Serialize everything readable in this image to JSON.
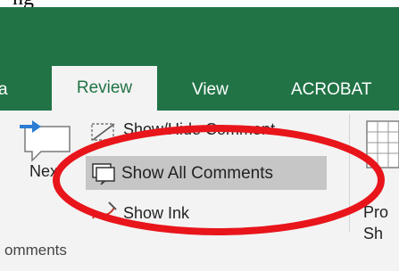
{
  "caption": {
    "text": "ng"
  },
  "tabs": [
    {
      "label": "a"
    },
    {
      "label": "Review",
      "active": true
    },
    {
      "label": "View"
    },
    {
      "label": "ACROBAT"
    }
  ],
  "ribbon": {
    "next_label": "Nex",
    "commands": [
      {
        "label": "Show/Hide Comment"
      },
      {
        "label": "Show All Comments",
        "highlighted": true
      },
      {
        "label": "Show Ink"
      }
    ],
    "pro_lines": [
      "Pro",
      "Sh"
    ],
    "group_label": "omments"
  },
  "colors": {
    "brand": "#217346",
    "ribbon_bg": "#f3f3f3",
    "highlight": "#c6c6c6",
    "annotation": "#e8151b"
  },
  "icons": [
    "next-comment-icon",
    "show-hide-comment-icon",
    "show-all-comments-icon",
    "show-ink-icon",
    "protect-sheet-icon"
  ]
}
